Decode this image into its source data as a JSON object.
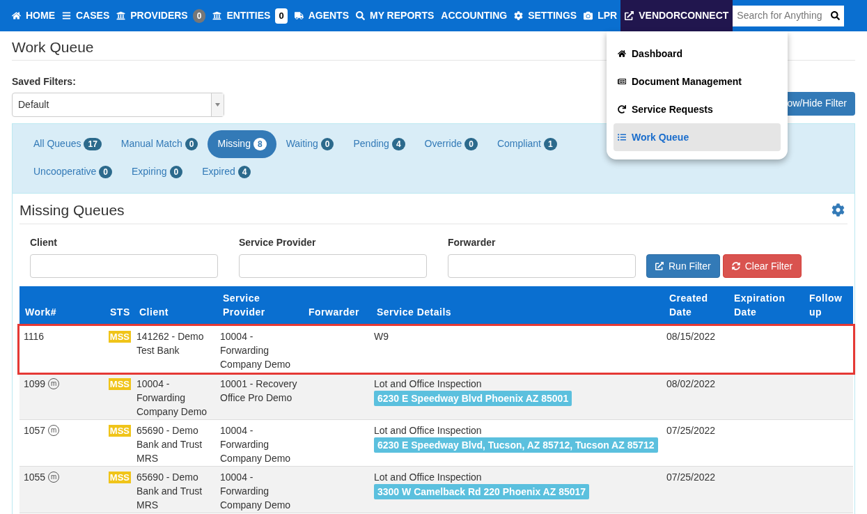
{
  "nav": {
    "items": [
      {
        "label": "HOME",
        "selected": false
      },
      {
        "label": "CASES",
        "selected": false
      },
      {
        "label": "PROVIDERS",
        "selected": false,
        "badge": {
          "text": "0",
          "kind": "pill"
        }
      },
      {
        "label": "ENTITIES",
        "selected": false,
        "badge": {
          "text": "0",
          "kind": "light"
        }
      },
      {
        "label": "AGENTS",
        "selected": false
      },
      {
        "label": "MY REPORTS",
        "selected": false
      },
      {
        "label": "ACCOUNTING",
        "selected": false
      },
      {
        "label": "SETTINGS",
        "selected": false
      },
      {
        "label": "LPR",
        "selected": false
      },
      {
        "label": "VENDORCONNECT",
        "selected": true
      }
    ],
    "search": {
      "placeholder": "Search for Anything"
    }
  },
  "dropdown": {
    "items": [
      {
        "label": "Dashboard",
        "selected": false
      },
      {
        "label": "Document Management",
        "selected": false
      },
      {
        "label": "Service Requests",
        "selected": false
      },
      {
        "label": "Work Queue",
        "selected": true
      }
    ]
  },
  "page_title": "Work Queue",
  "saved_filters": {
    "label": "Saved Filters:",
    "value": "Default"
  },
  "toggle_button": "ow/Hide Filter",
  "queue_tabs": [
    {
      "label": "All Queues",
      "count": "17",
      "selected": false
    },
    {
      "label": "Manual Match",
      "count": "0",
      "selected": false
    },
    {
      "label": "Missing",
      "count": "8",
      "selected": true
    },
    {
      "label": "Waiting",
      "count": "0",
      "selected": false
    },
    {
      "label": "Pending",
      "count": "4",
      "selected": false
    },
    {
      "label": "Override",
      "count": "0",
      "selected": false
    },
    {
      "label": "Compliant",
      "count": "1",
      "selected": false
    },
    {
      "label": "Uncooperative",
      "count": "0",
      "selected": false
    },
    {
      "label": "Expiring",
      "count": "0",
      "selected": false
    },
    {
      "label": "Expired",
      "count": "4",
      "selected": false
    }
  ],
  "section_title": "Missing Queues",
  "filters": [
    {
      "label": "Client"
    },
    {
      "label": "Service Provider"
    },
    {
      "label": "Forwarder"
    }
  ],
  "filter_buttons": [
    {
      "label": "Run Filter",
      "kind": "run"
    },
    {
      "label": "Clear Filter",
      "kind": "clear"
    }
  ],
  "table": {
    "columns": [
      "Work#",
      "STS",
      "Client",
      "Service Provider",
      "Forwarder",
      "Service Details",
      "Created Date",
      "Expiration Date",
      "Follow up"
    ],
    "rows": [
      {
        "work": "1116",
        "status": "MSS",
        "client": "141262 - Demo Test Bank",
        "provider": "10004 - Forwarding Company Demo",
        "details": "W9",
        "created": "08/15/2022",
        "highlighted": true
      },
      {
        "work": "1099",
        "marker": "m",
        "status": "MSS",
        "client": "10004 - Forwarding Company Demo",
        "provider": "10001 - Recovery Office Pro Demo",
        "details": "Lot and Office Inspection",
        "address": "6230 E Speedway Blvd Phoenix AZ 85001",
        "created": "08/02/2022",
        "highlighted": false
      },
      {
        "work": "1057",
        "marker": "m",
        "status": "MSS",
        "client": "65690 - Demo Bank and Trust MRS",
        "provider": "10004 - Forwarding Company Demo",
        "details": "Lot and Office Inspection",
        "address": "6230 E Speedway Blvd, Tucson, AZ 85712, Tucson AZ 85712",
        "created": "07/25/2022",
        "highlighted": false
      },
      {
        "work": "1055",
        "marker": "m",
        "status": "MSS",
        "client": "65690 - Demo Bank and Trust MRS",
        "provider": "10004 - Forwarding Company Demo",
        "details": "Lot and Office Inspection",
        "address": "3300 W Camelback Rd 220 Phoenix AZ 85017",
        "created": "07/25/2022",
        "highlighted": false
      }
    ]
  }
}
